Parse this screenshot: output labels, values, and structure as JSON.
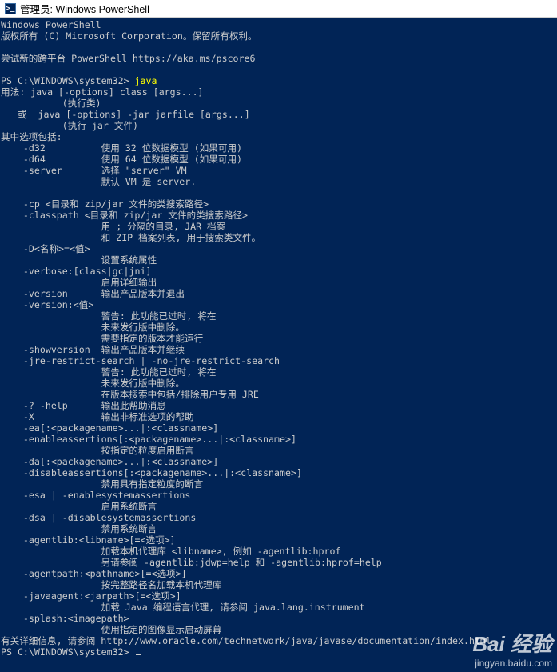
{
  "window": {
    "title": "管理员: Windows PowerShell",
    "icon": "powershell-icon"
  },
  "console": {
    "lines": [
      "Windows PowerShell",
      "版权所有 (C) Microsoft Corporation。保留所有权利。",
      "",
      "尝试新的跨平台 PowerShell https://aka.ms/pscore6",
      "",
      "PS C:\\WINDOWS\\system32> java",
      "用法: java [-options] class [args...]",
      "           (执行类)",
      "   或  java [-options] -jar jarfile [args...]",
      "           (执行 jar 文件)",
      "其中选项包括:",
      "    -d32          使用 32 位数据模型 (如果可用)",
      "    -d64          使用 64 位数据模型 (如果可用)",
      "    -server       选择 \"server\" VM",
      "                  默认 VM 是 server.",
      "",
      "    -cp <目录和 zip/jar 文件的类搜索路径>",
      "    -classpath <目录和 zip/jar 文件的类搜索路径>",
      "                  用 ; 分隔的目录, JAR 档案",
      "                  和 ZIP 档案列表, 用于搜索类文件。",
      "    -D<名称>=<值>",
      "                  设置系统属性",
      "    -verbose:[class|gc|jni]",
      "                  启用详细输出",
      "    -version      输出产品版本并退出",
      "    -version:<值>",
      "                  警告: 此功能已过时, 将在",
      "                  未来发行版中删除。",
      "                  需要指定的版本才能运行",
      "    -showversion  输出产品版本并继续",
      "    -jre-restrict-search | -no-jre-restrict-search",
      "                  警告: 此功能已过时, 将在",
      "                  未来发行版中删除。",
      "                  在版本搜索中包括/排除用户专用 JRE",
      "    -? -help      输出此帮助消息",
      "    -X            输出非标准选项的帮助",
      "    -ea[:<packagename>...|:<classname>]",
      "    -enableassertions[:<packagename>...|:<classname>]",
      "                  按指定的粒度启用断言",
      "    -da[:<packagename>...|:<classname>]",
      "    -disableassertions[:<packagename>...|:<classname>]",
      "                  禁用具有指定粒度的断言",
      "    -esa | -enablesystemassertions",
      "                  启用系统断言",
      "    -dsa | -disablesystemassertions",
      "                  禁用系统断言",
      "    -agentlib:<libname>[=<选项>]",
      "                  加载本机代理库 <libname>, 例如 -agentlib:hprof",
      "                  另请参阅 -agentlib:jdwp=help 和 -agentlib:hprof=help",
      "    -agentpath:<pathname>[=<选项>]",
      "                  按完整路径名加载本机代理库",
      "    -javaagent:<jarpath>[=<选项>]",
      "                  加载 Java 编程语言代理, 请参阅 java.lang.instrument",
      "    -splash:<imagepath>",
      "                  使用指定的图像显示启动屏幕",
      "有关详细信息, 请参阅 http://www.oracle.com/technetwork/java/javase/documentation/index.html。"
    ],
    "prompt_line": "PS C:\\WINDOWS\\system32> ",
    "command_line_prefix": "PS C:\\WINDOWS\\system32> ",
    "command": "java"
  },
  "watermark": {
    "brand": "Bai 经验",
    "site": "jingyan.baidu.com"
  },
  "colors": {
    "background": "#012456",
    "text": "#cccccc",
    "command": "#ffff00"
  }
}
